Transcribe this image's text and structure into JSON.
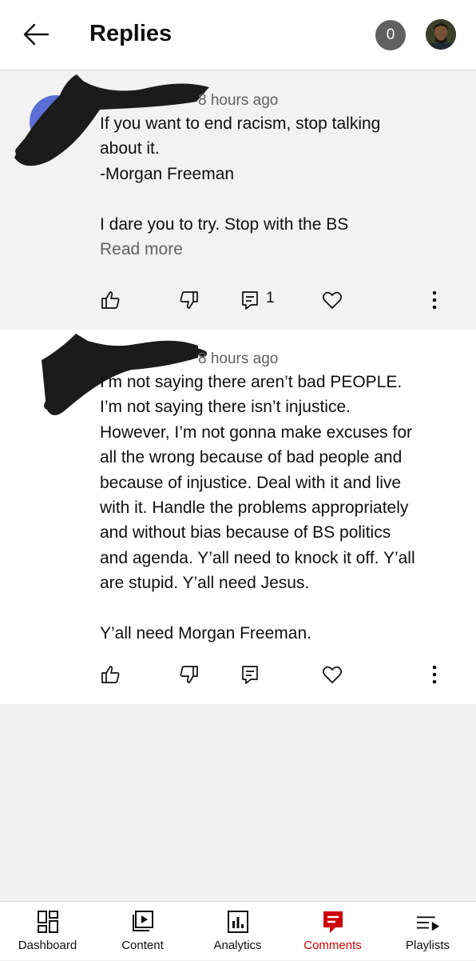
{
  "header": {
    "title": "Replies",
    "notification_count": "0",
    "back_icon": "arrow-left-icon",
    "avatar_icon": "user-avatar"
  },
  "replies": [
    {
      "time": "8 hours ago",
      "lines": [
        "If you want to end racism, stop talking",
        "about it.",
        "-Morgan Freeman",
        "",
        "I dare you to try. Stop with the BS"
      ],
      "read_more": "Read more",
      "reply_count": "1"
    },
    {
      "time": "8 hours ago",
      "lines": [
        "I’m not saying there aren’t bad PEOPLE.",
        "I’m not saying there isn’t injustice.",
        "However, I’m not gonna make excuses for",
        "all the wrong because of bad people and",
        "because of injustice. Deal with it and live",
        "with it. Handle the problems appropriately",
        "and without bias because of BS politics",
        "and agenda. Y’all need to knock it off. Y’all",
        "are stupid. Y’all need Jesus.",
        "",
        "Y’all need Morgan Freeman."
      ]
    }
  ],
  "bottom_nav": [
    {
      "label": "Dashboard",
      "icon": "dashboard-icon",
      "active": false
    },
    {
      "label": "Content",
      "icon": "content-icon",
      "active": false
    },
    {
      "label": "Analytics",
      "icon": "analytics-icon",
      "active": false
    },
    {
      "label": "Comments",
      "icon": "comments-icon",
      "active": true
    },
    {
      "label": "Playlists",
      "icon": "playlists-icon",
      "active": false
    }
  ],
  "colors": {
    "accent": "#cc0000",
    "secondary_text": "#606060",
    "redaction": "#1b1b1b",
    "avatar_ring": "#5b6fd6"
  }
}
